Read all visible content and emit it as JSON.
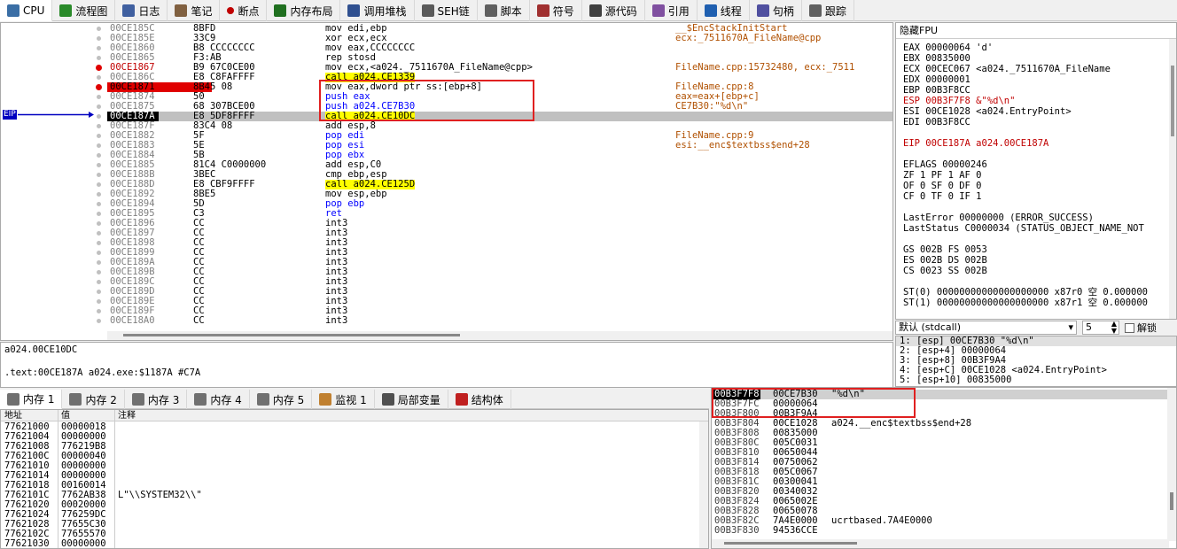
{
  "tabs": [
    "CPU",
    "流程图",
    "日志",
    "笔记",
    "断点",
    "内存布局",
    "调用堆栈",
    "SEH链",
    "脚本",
    "符号",
    "源代码",
    "引用",
    "线程",
    "句柄",
    "跟踪"
  ],
  "tab_icons": [
    "cpu-icon",
    "graph-icon",
    "log-icon",
    "notes-icon",
    "breakpoint-icon",
    "memory-map-icon",
    "call-stack-icon",
    "seh-icon",
    "script-icon",
    "symbols-icon",
    "source-icon",
    "references-icon",
    "threads-icon",
    "handles-icon",
    "trace-icon"
  ],
  "eip_label": "EIP",
  "disasm": [
    {
      "a": "00CE185C",
      "b": "8BFD",
      "i": "mov edi,ebp",
      "c": "__$EncStackInitStart"
    },
    {
      "a": "00CE185E",
      "b": "33C9",
      "i": "xor ecx,ecx",
      "c": "ecx:_7511670A_FileName@cpp"
    },
    {
      "a": "00CE1860",
      "b": "B8 CCCCCCCC",
      "i": "mov eax,CCCCCCCC",
      "c": ""
    },
    {
      "a": "00CE1865",
      "b": "F3:AB",
      "i": "rep stosd",
      "c": ""
    },
    {
      "a": "00CE1867",
      "b": "B9 67C0CE00",
      "i": "mov ecx,<a024._7511670A_FileName@cpp>",
      "c": "FileName.cpp:15732480, ecx:_7511"
    },
    {
      "a": "00CE186C",
      "b": "E8 C8FAFFFF",
      "i": "call a024.CE1339",
      "c": ""
    },
    {
      "a": "00CE1871",
      "b": "8B45 08",
      "i": "mov eax,dword ptr ss:[ebp+8]",
      "c": "FileName.cpp:8"
    },
    {
      "a": "00CE1874",
      "b": "50",
      "i": "push eax",
      "c": "eax=eax+[ebp+c]"
    },
    {
      "a": "00CE1875",
      "b": "68 307BCE00",
      "i": "push a024.CE7B30",
      "c": "CE7B30:\"%d\\n\""
    },
    {
      "a": "00CE187A",
      "b": "E8 5DF8FFFF",
      "i": "call a024.CE10DC",
      "c": ""
    },
    {
      "a": "00CE187F",
      "b": "83C4 08",
      "i": "add esp,8",
      "c": ""
    },
    {
      "a": "00CE1882",
      "b": "5F",
      "i": "pop edi",
      "c": "FileName.cpp:9"
    },
    {
      "a": "00CE1883",
      "b": "5E",
      "i": "pop esi",
      "c": "esi:__enc$textbss$end+28"
    },
    {
      "a": "00CE1884",
      "b": "5B",
      "i": "pop ebx",
      "c": ""
    },
    {
      "a": "00CE1885",
      "b": "81C4 C0000000",
      "i": "add esp,C0",
      "c": ""
    },
    {
      "a": "00CE188B",
      "b": "3BEC",
      "i": "cmp ebp,esp",
      "c": ""
    },
    {
      "a": "00CE188D",
      "b": "E8 CBF9FFFF",
      "i": "call a024.CE125D",
      "c": ""
    },
    {
      "a": "00CE1892",
      "b": "8BE5",
      "i": "mov esp,ebp",
      "c": ""
    },
    {
      "a": "00CE1894",
      "b": "5D",
      "i": "pop ebp",
      "c": ""
    },
    {
      "a": "00CE1895",
      "b": "C3",
      "i": "ret",
      "c": ""
    },
    {
      "a": "00CE1896",
      "b": "CC",
      "i": "int3",
      "c": ""
    },
    {
      "a": "00CE1897",
      "b": "CC",
      "i": "int3",
      "c": ""
    },
    {
      "a": "00CE1898",
      "b": "CC",
      "i": "int3",
      "c": ""
    },
    {
      "a": "00CE1899",
      "b": "CC",
      "i": "int3",
      "c": ""
    },
    {
      "a": "00CE189A",
      "b": "CC",
      "i": "int3",
      "c": ""
    },
    {
      "a": "00CE189B",
      "b": "CC",
      "i": "int3",
      "c": ""
    },
    {
      "a": "00CE189C",
      "b": "CC",
      "i": "int3",
      "c": ""
    },
    {
      "a": "00CE189D",
      "b": "CC",
      "i": "int3",
      "c": ""
    },
    {
      "a": "00CE189E",
      "b": "CC",
      "i": "int3",
      "c": ""
    },
    {
      "a": "00CE189F",
      "b": "CC",
      "i": "int3",
      "c": ""
    },
    {
      "a": "00CE18A0",
      "b": "CC",
      "i": "int3",
      "c": ""
    }
  ],
  "regs_header": "隐藏FPU",
  "regs": [
    "EAX    00000064      'd'",
    "EBX    00835000",
    "ECX    00CEC067      <a024._7511670A_FileName",
    "EDX    00000001",
    "EBP    00B3F8CC",
    "ESP    00B3F7F8      &\"%d\\n\"",
    "ESI    00CE1028      <a024.EntryPoint>",
    "EDI    00B3F8CC",
    "",
    "EIP    00CE187A      a024.00CE187A",
    "",
    "EFLAGS   00000246",
    "ZF 1  PF 1  AF 0",
    "OF 0  SF 0  DF 0",
    "CF 0  TF 0  IF 1",
    "",
    "LastError  00000000 (ERROR_SUCCESS)",
    "LastStatus C0000034 (STATUS_OBJECT_NAME_NOT",
    "",
    "GS 002B  FS 0053",
    "ES 002B  DS 002B",
    "CS 0023  SS 002B",
    "",
    "ST(0) 00000000000000000000 x87r0 空 0.000000",
    "ST(1) 00000000000000000000 x87r1 空 0.000000"
  ],
  "callconv": {
    "value": "默认 (stdcall)",
    "count": "5",
    "unlock": "解锁"
  },
  "args": [
    "1: [esp] 00CE7B30 \"%d\\n\"",
    "2: [esp+4] 00000064",
    "3: [esp+8] 00B3F9A4",
    "4: [esp+C] 00CE1028 <a024.EntryPoint>",
    "5: [esp+10] 00835000"
  ],
  "info": [
    "a024.00CE10DC",
    "",
    ".text:00CE187A a024.exe:$1187A #C7A"
  ],
  "memtabs": [
    "内存 1",
    "内存 2",
    "内存 3",
    "内存 4",
    "内存 5",
    "监视 1",
    "局部变量",
    "结构体"
  ],
  "mem_headers": [
    "地址",
    "值",
    "注释"
  ],
  "mem": [
    [
      "77621000",
      "00000018",
      ""
    ],
    [
      "77621004",
      "00000000",
      ""
    ],
    [
      "77621008",
      "776219B8",
      ""
    ],
    [
      "7762100C",
      "00000040",
      ""
    ],
    [
      "77621010",
      "00000000",
      ""
    ],
    [
      "77621014",
      "00000000",
      ""
    ],
    [
      "77621018",
      "00160014",
      ""
    ],
    [
      "7762101C",
      "7762AB38",
      "L\"\\\\SYSTEM32\\\\\""
    ],
    [
      "77621020",
      "00020000",
      ""
    ],
    [
      "77621024",
      "776259DC",
      ""
    ],
    [
      "77621028",
      "77655C30",
      ""
    ],
    [
      "7762102C",
      "77655570",
      ""
    ],
    [
      "77621030",
      "00000000",
      ""
    ]
  ],
  "stack": [
    [
      "00B3F7F8",
      "00CE7B30",
      "\"%d\\n\""
    ],
    [
      "00B3F7FC",
      "00000064",
      ""
    ],
    [
      "00B3F800",
      "00B3F9A4",
      ""
    ],
    [
      "00B3F804",
      "00CE1028",
      "a024.__enc$textbss$end+28"
    ],
    [
      "00B3F808",
      "00835000",
      ""
    ],
    [
      "00B3F80C",
      "005C0031",
      ""
    ],
    [
      "00B3F810",
      "00650044",
      ""
    ],
    [
      "00B3F814",
      "00750062",
      ""
    ],
    [
      "00B3F818",
      "005C0067",
      ""
    ],
    [
      "00B3F81C",
      "00300041",
      ""
    ],
    [
      "00B3F820",
      "00340032",
      ""
    ],
    [
      "00B3F824",
      "0065002E",
      ""
    ],
    [
      "00B3F828",
      "00650078",
      ""
    ],
    [
      "00B3F82C",
      "7A4E0000",
      "ucrtbased.7A4E0000"
    ],
    [
      "00B3F830",
      "94536CCE",
      ""
    ]
  ]
}
